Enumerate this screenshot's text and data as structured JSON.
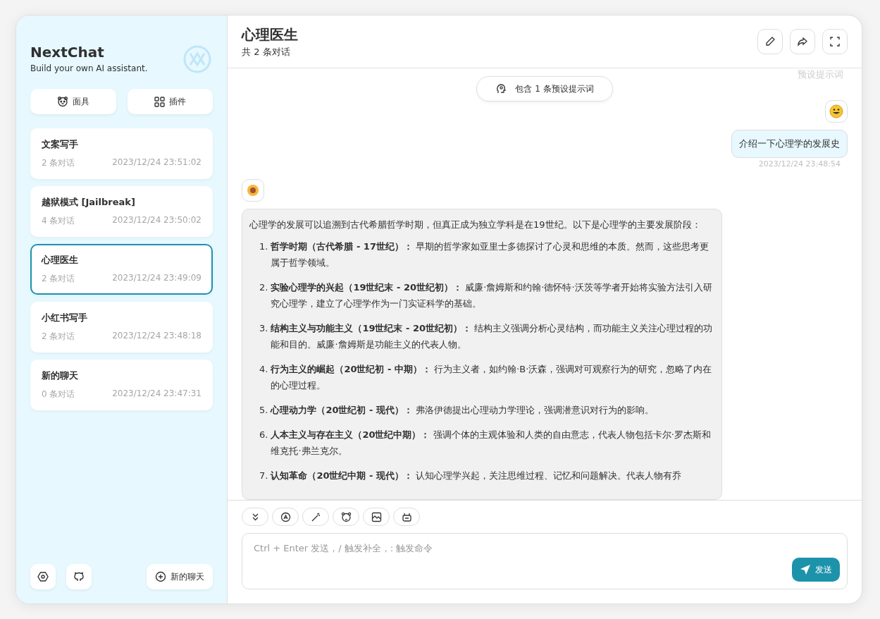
{
  "sidebar": {
    "title": "NextChat",
    "subtitle": "Build your own AI assistant.",
    "buttons": [
      {
        "kind": "mask",
        "label": "面具"
      },
      {
        "kind": "plugin",
        "label": "插件"
      }
    ],
    "sessions": [
      {
        "title": "文案写手",
        "count": "2 条对话",
        "time": "2023/12/24 23:51:02",
        "selected": false
      },
      {
        "title": "越狱模式 [Jailbreak]",
        "count": "4 条对话",
        "time": "2023/12/24 23:50:02",
        "selected": false
      },
      {
        "title": "心理医生",
        "count": "2 条对话",
        "time": "2023/12/24 23:49:09",
        "selected": true
      },
      {
        "title": "小红书写手",
        "count": "2 条对话",
        "time": "2023/12/24 23:48:18",
        "selected": false
      },
      {
        "title": "新的聊天",
        "count": "0 条对话",
        "time": "2023/12/24 23:47:31",
        "selected": false
      }
    ],
    "new_chat": "新的聊天"
  },
  "chat": {
    "title": "心理医生",
    "subtitle": "共 2 条对话",
    "scrolled_text": "预设提示词",
    "prompt_chip": "包含 1 条预设提示词",
    "messages": [
      {
        "kind": "user",
        "text": "介绍一下心理学的发展史",
        "time": "2023/12/24 23:48:54"
      },
      {
        "kind": "assistant",
        "intro": "心理学的发展可以追溯到古代希腊哲学时期，但真正成为独立学科是在19世纪。以下是心理学的主要发展阶段：",
        "items": [
          {
            "number": "1.",
            "text": "**哲学时期（古代希腊 - 17世纪）：** 早期的哲学家如亚里士多德探讨了心灵和思维的本质。然而，这些思考更属于哲学领域。"
          },
          {
            "number": "2.",
            "text": "**实验心理学的兴起（19世纪末 - 20世纪初）：** 威廉·詹姆斯和约翰·德怀特·沃茨等学者开始将实验方法引入研究心理学，建立了心理学作为一门实证科学的基础。"
          },
          {
            "number": "3.",
            "text": "**结构主义与功能主义（19世纪末 - 20世纪初）：** 结构主义强调分析心灵结构，而功能主义关注心理过程的功能和目的。威廉·詹姆斯是功能主义的代表人物。"
          },
          {
            "number": "4.",
            "text": "**行为主义的崛起（20世纪初 - 中期）：** 行为主义者，如约翰·B·沃森，强调对可观察行为的研究，忽略了内在的心理过程。"
          },
          {
            "number": "5.",
            "text": "**心理动力学（20世纪初 - 现代）：** 弗洛伊德提出心理动力学理论，强调潜意识对行为的影响。"
          },
          {
            "number": "6.",
            "text": "**人本主义与存在主义（20世纪中期）：** 强调个体的主观体验和人类的自由意志，代表人物包括卡尔·罗杰斯和维克托·弗兰克尔。"
          },
          {
            "number": "7.",
            "text": "**认知革命（20世纪中期 - 现代）：** 认知心理学兴起，关注思维过程、记忆和问题解决。代表人物有乔"
          }
        ]
      }
    ],
    "input": {
      "placeholder": "Ctrl + Enter 发送，/ 触发补全，: 触发命令",
      "send": "发送"
    }
  }
}
